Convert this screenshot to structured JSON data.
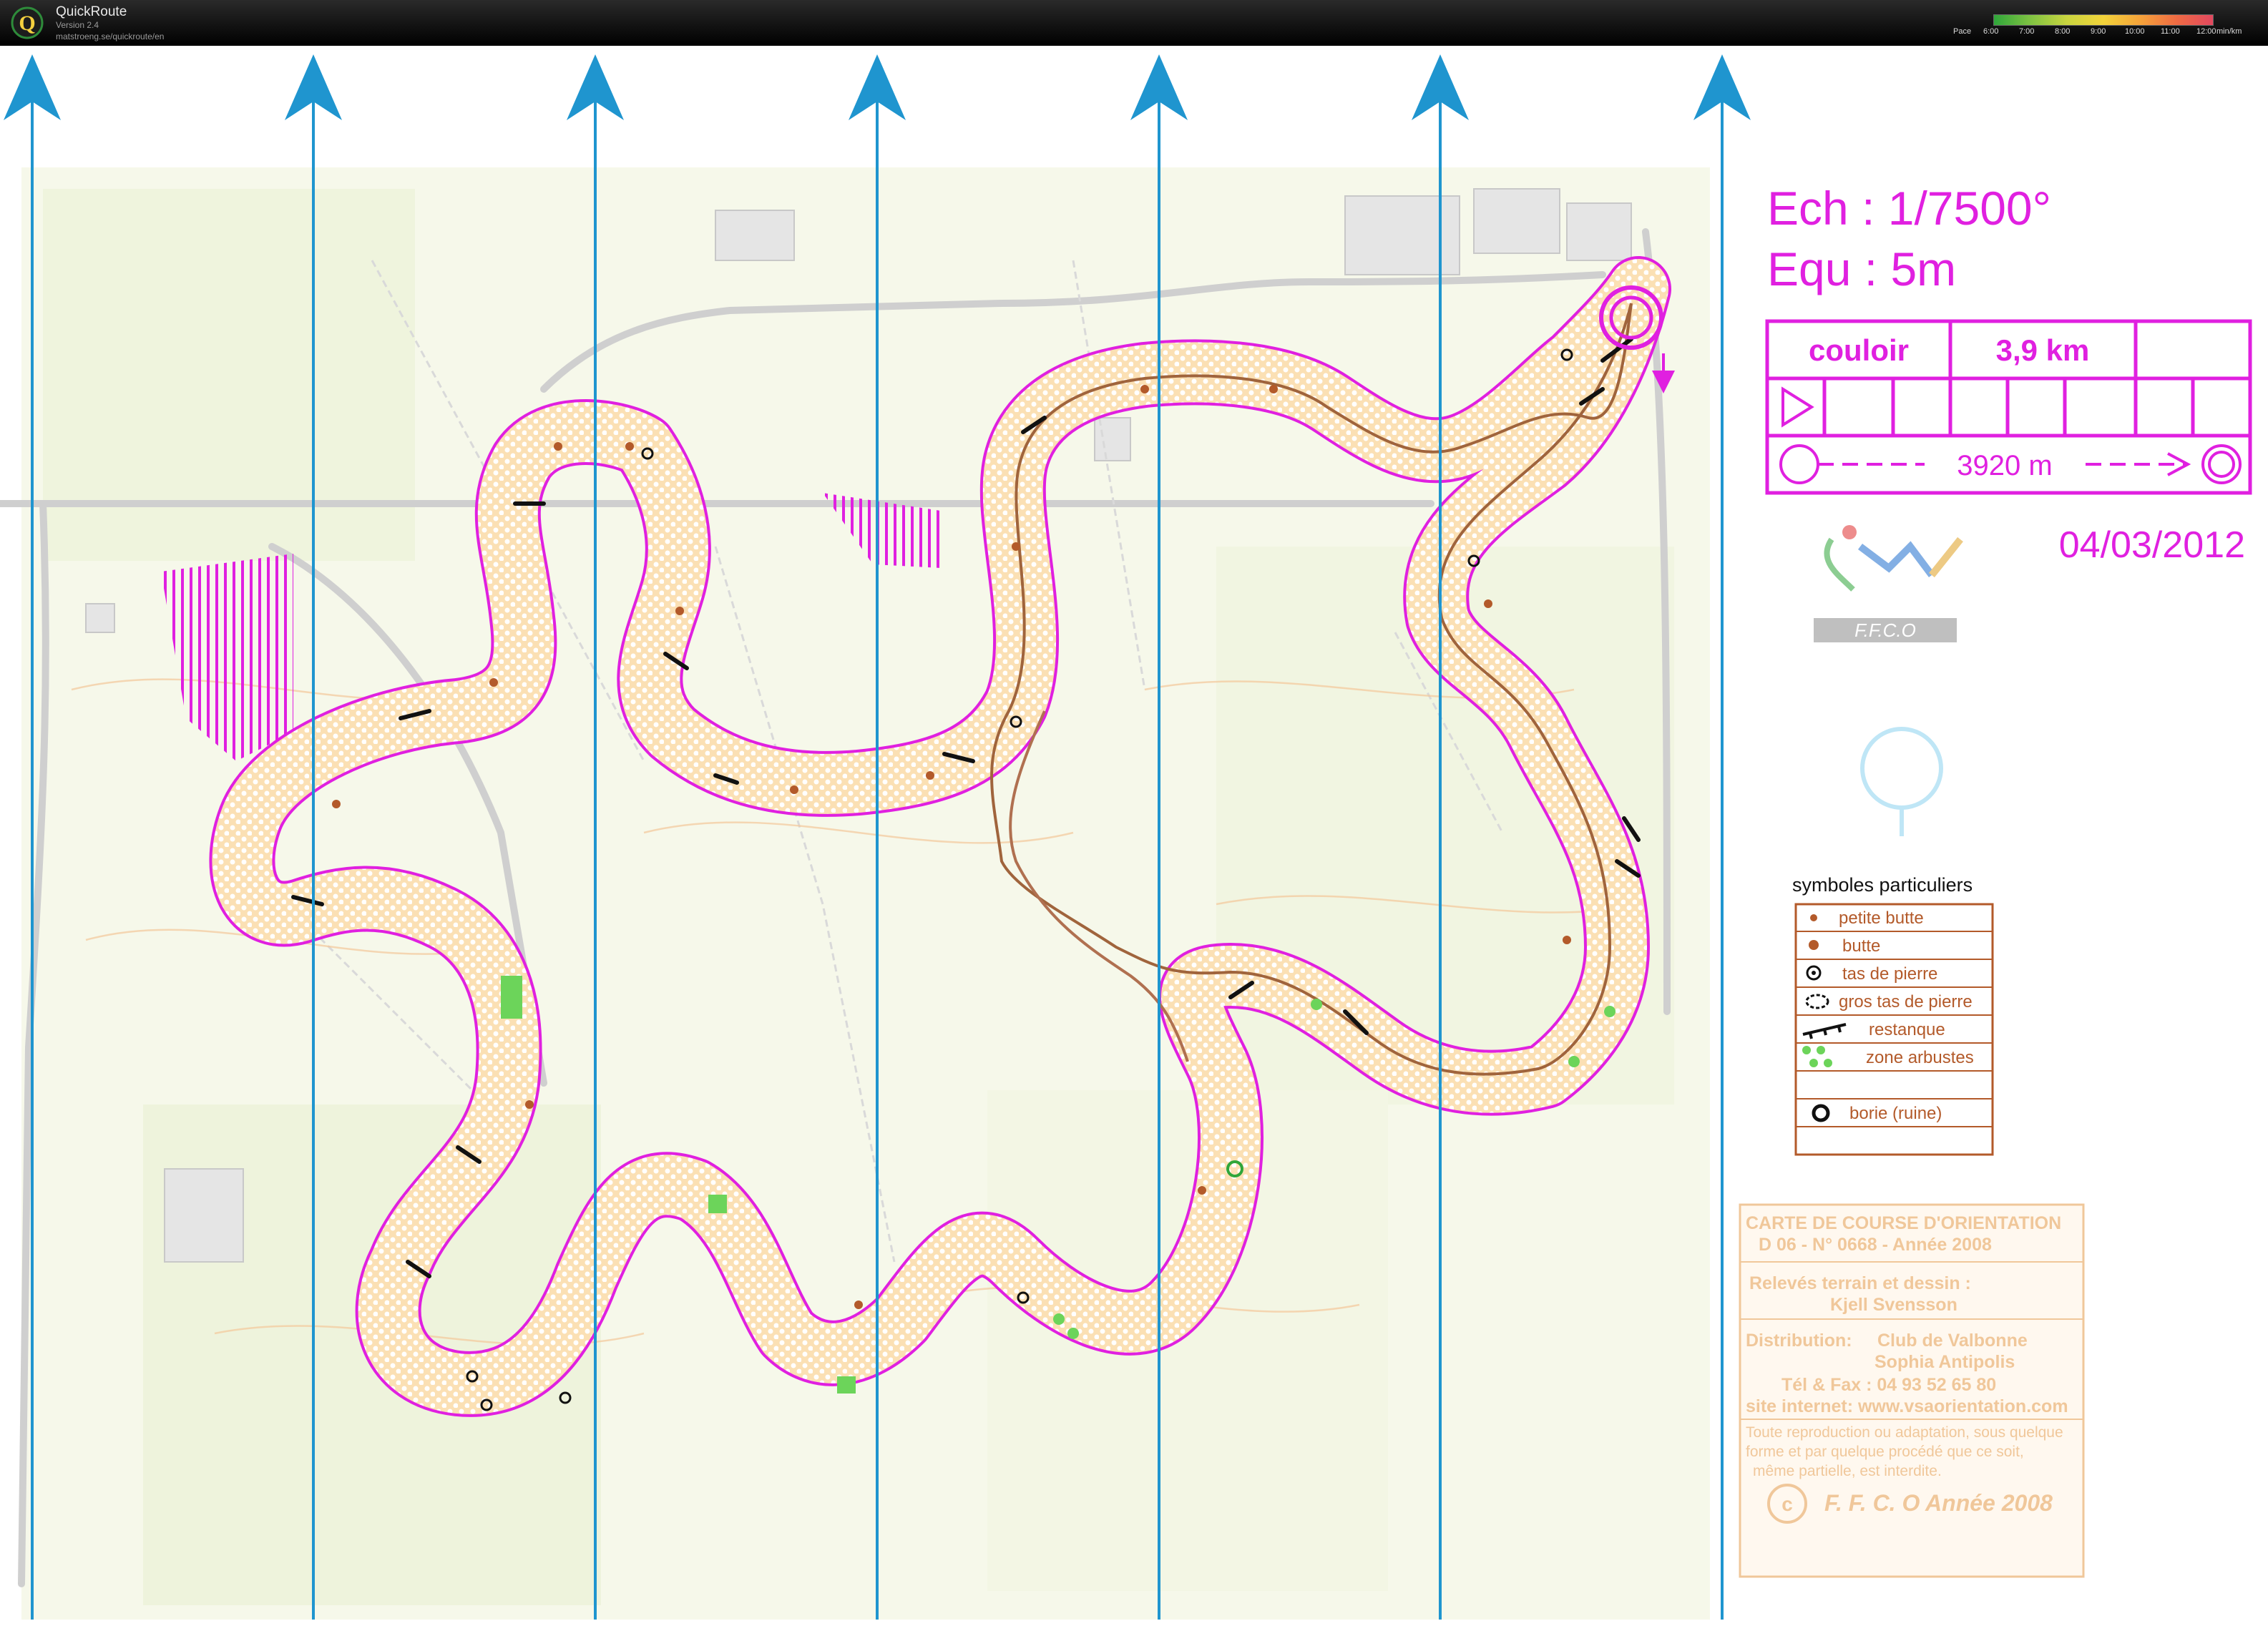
{
  "app": {
    "title": "QuickRoute",
    "version": "Version 2.4",
    "url": "matstroeng.se/quickroute/en"
  },
  "pace_legend": {
    "label": "Pace",
    "ticks": [
      "6:00",
      "7:00",
      "8:00",
      "9:00",
      "10:00",
      "11:00",
      "12:00"
    ],
    "unit": "min/km"
  },
  "map_info": {
    "scale": "Ech : 1/7500°",
    "equidistance": "Equ : 5m",
    "course_name": "couloir",
    "course_length": "3,9 km",
    "distance_line": "3920 m",
    "date": "04/03/2012",
    "federation_logo_text": "F.F.C.O"
  },
  "legend": {
    "title": "symboles particuliers",
    "items": [
      {
        "label": "petite butte",
        "icon": "small-knoll-icon"
      },
      {
        "label": "butte",
        "icon": "knoll-icon"
      },
      {
        "label": "tas de pierre",
        "icon": "stone-pile-icon"
      },
      {
        "label": "gros tas de pierre",
        "icon": "large-stone-pile-icon"
      },
      {
        "label": "restanque",
        "icon": "terrace-wall-icon"
      },
      {
        "label": "zone arbustes",
        "icon": "shrub-zone-icon"
      },
      {
        "label": "borie (ruine)",
        "icon": "ruin-icon"
      }
    ]
  },
  "copyright": {
    "line1": "CARTE DE COURSE D'ORIENTATION",
    "line2": "D 06 - N° 0668 - Année 2008",
    "line3": "Relevés terrain  et dessin :",
    "line4": "Kjell Svensson",
    "line5a": "Distribution:",
    "line5b": "Club de Valbonne",
    "line6": "Sophia Antipolis",
    "line7": "Tél & Fax : 04 93 52 65 80",
    "line8": "site internet: www.vsaorientation.com",
    "line9": "Toute reproduction ou adaptation, sous quelque",
    "line10": "forme et par quelque procédé  que ce soit,",
    "line11": "même partielle, est interdite.",
    "line12": "F. F. C. O Année 2008"
  },
  "colors": {
    "course": "#e020e0",
    "north_lines": "#1f95cf",
    "route": "#a0643c",
    "open_land": "#fbe0b4"
  }
}
